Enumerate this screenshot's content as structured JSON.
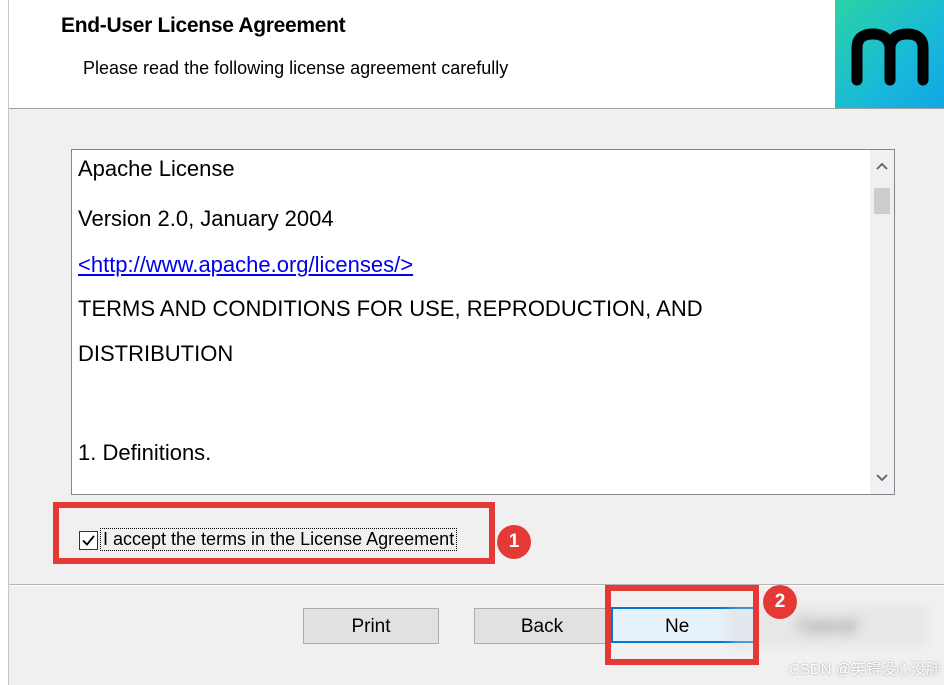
{
  "header": {
    "title": "End-User License Agreement",
    "subtitle": "Please read the following license agreement carefully",
    "logo_letter": "m",
    "logo_colors": [
      "#2bd3a6",
      "#12a6e6"
    ]
  },
  "license": {
    "lines": [
      "Apache License",
      "Version 2.0, January 2004",
      "<http://www.apache.org/licenses/>",
      "TERMS AND CONDITIONS FOR USE, REPRODUCTION, AND",
      "DISTRIBUTION",
      "1. Definitions."
    ],
    "link_color": "#0000ee"
  },
  "scrollbar": {
    "up_icon": "chevron-up-icon",
    "down_icon": "chevron-down-icon",
    "up_glyph": "^",
    "down_glyph": "v"
  },
  "accept": {
    "checked": true,
    "label": "I accept the terms in the License Agreement"
  },
  "annotations": {
    "badge1": "1",
    "badge2": "2",
    "highlight_color": "#e53935"
  },
  "buttons": {
    "print": "Print",
    "back": "Back",
    "next": "Ne",
    "cancel": "Cancel"
  },
  "watermark": "CSDN @笑锝没心没肺"
}
